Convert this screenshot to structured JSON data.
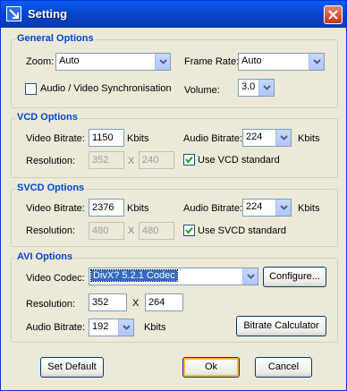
{
  "window": {
    "title": "Setting"
  },
  "general": {
    "legend": "General Options",
    "zoom_label": "Zoom:",
    "zoom_value": "Auto",
    "frame_rate_label": "Frame Rate:",
    "frame_rate_value": "Auto",
    "av_sync_label": "Audio / Video Synchronisation",
    "av_sync_checked": false,
    "volume_label": "Volume:",
    "volume_value": "3.0"
  },
  "vcd": {
    "legend": "VCD Options",
    "video_bitrate_label": "Video Bitrate:",
    "video_bitrate_value": "1150",
    "video_bitrate_unit": "Kbits",
    "audio_bitrate_label": "Audio Bitrate:",
    "audio_bitrate_value": "224",
    "audio_bitrate_unit": "Kbits",
    "resolution_label": "Resolution:",
    "res_width": "352",
    "res_sep": "X",
    "res_height": "240",
    "use_standard_label": "Use VCD standard",
    "use_standard_checked": true
  },
  "svcd": {
    "legend": "SVCD Options",
    "video_bitrate_label": "Video Bitrate:",
    "video_bitrate_value": "2376",
    "video_bitrate_unit": "Kbits",
    "audio_bitrate_label": "Audio Bitrate:",
    "audio_bitrate_value": "224",
    "audio_bitrate_unit": "Kbits",
    "resolution_label": "Resolution:",
    "res_width": "480",
    "res_sep": "X",
    "res_height": "480",
    "use_standard_label": "Use SVCD standard",
    "use_standard_checked": true
  },
  "avi": {
    "legend": "AVI Options",
    "codec_label": "Video Codec:",
    "codec_value": "DivX? 5.2.1 Codec",
    "configure_label": "Configure...",
    "resolution_label": "Resolution:",
    "res_width": "352",
    "res_sep": "X",
    "res_height": "264",
    "audio_bitrate_label": "Audio Bitrate:",
    "audio_bitrate_value": "192",
    "audio_bitrate_unit": "Kbits",
    "bitrate_calc_label": "Bitrate Calculator"
  },
  "footer": {
    "set_default_label": "Set Default",
    "ok_label": "Ok",
    "cancel_label": "Cancel"
  },
  "colors": {
    "titlebar": "#0842c6",
    "legend_text": "#0046d5",
    "dialog_bg": "#ece9d8",
    "selection": "#316ac5"
  },
  "icons": {
    "app": "app-arrow-icon",
    "close": "close-icon",
    "dropdown": "chevron-down-icon",
    "check": "checkmark-icon"
  }
}
